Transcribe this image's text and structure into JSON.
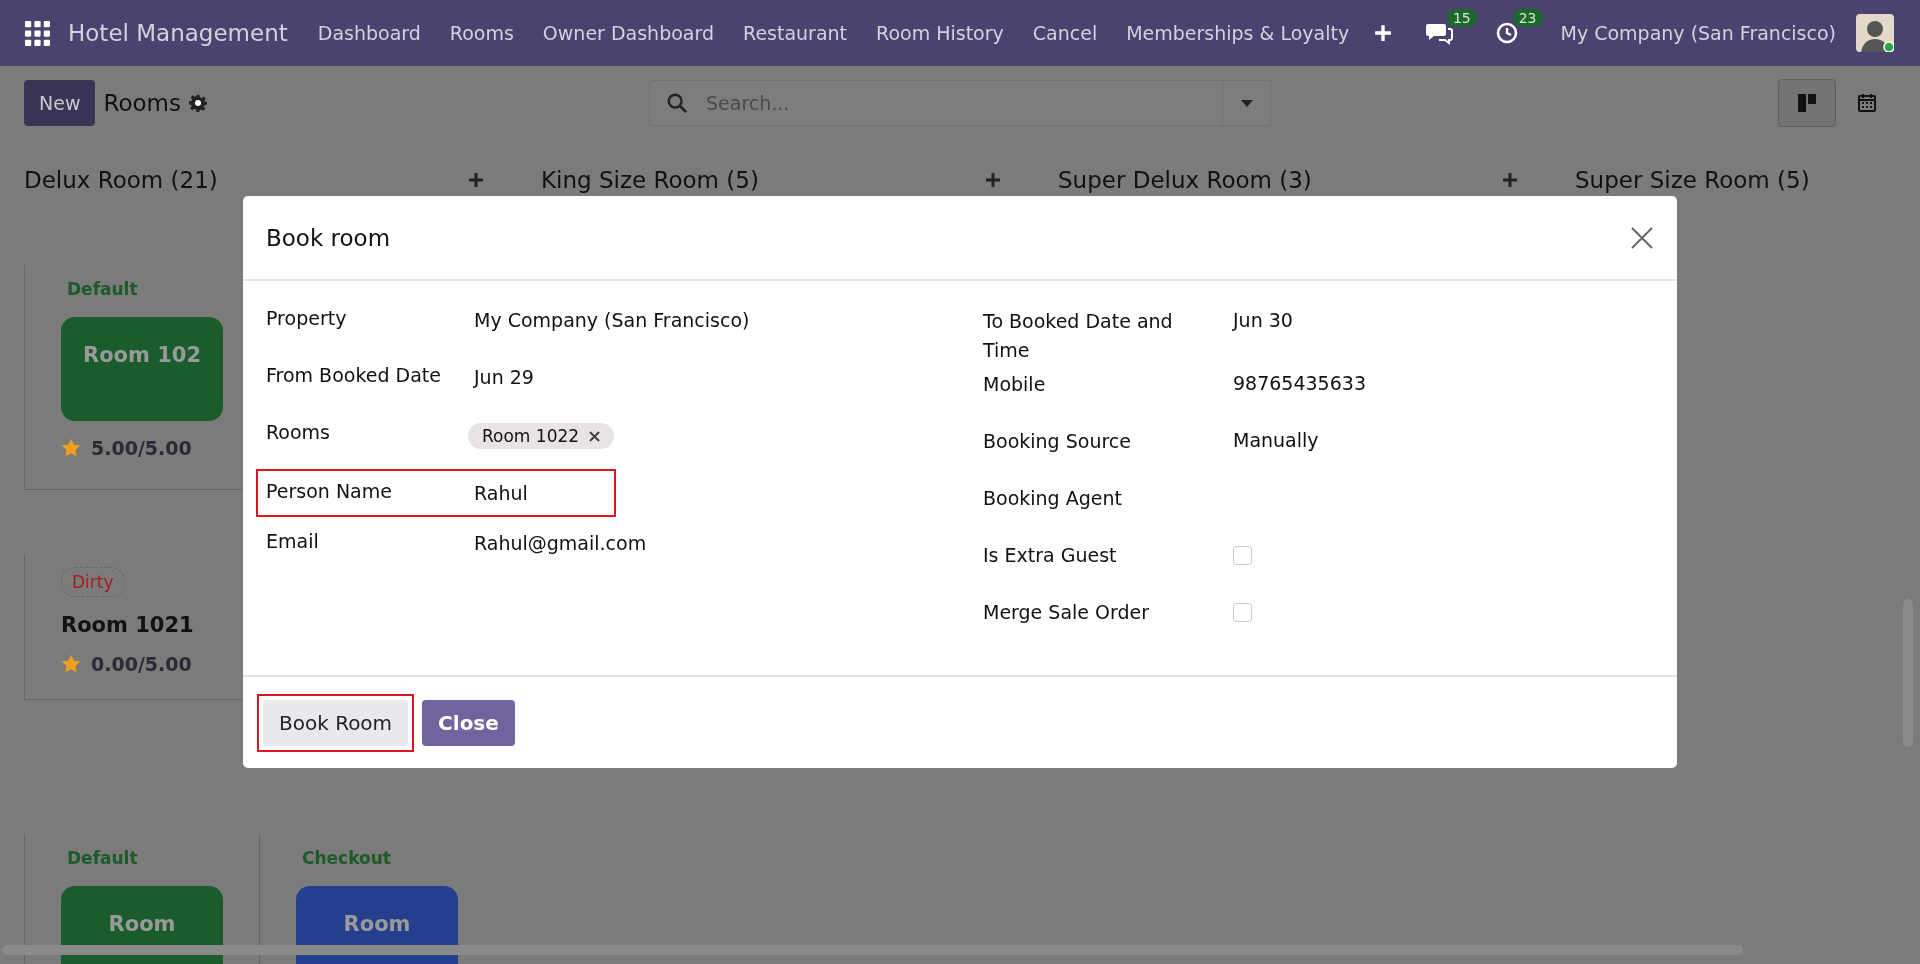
{
  "navbar": {
    "app_title": "Hotel Management",
    "menu": [
      "Dashboard",
      "Rooms",
      "Owner Dashboard",
      "Restaurant",
      "Room History",
      "Cancel",
      "Memberships & Loyalty"
    ],
    "messages_badge": "15",
    "activities_badge": "23",
    "company": "My Company (San Francisco)"
  },
  "control_panel": {
    "new_button": "New",
    "title": "Rooms",
    "search": {
      "placeholder": "Search..."
    },
    "views": [
      {
        "kind": "kanban",
        "selected": true
      },
      {
        "kind": "calendar",
        "selected": false
      }
    ]
  },
  "columns": [
    {
      "title": "Delux Room (21)",
      "cards": [
        {
          "kind": "tile",
          "status": {
            "label": "Default",
            "color": "#1d5a2a",
            "pill": false
          },
          "name": "Room 102",
          "color": "#1b5c2c",
          "rating": "5.00/5.00"
        },
        {
          "kind": "plain",
          "status": {
            "label": "Dirty",
            "color": "#a81c1c",
            "pill": true
          },
          "name": "Room 1021",
          "rating": "0.00/5.00"
        },
        {
          "kind": "tile",
          "status": {
            "label": "Default",
            "color": "#1d5a2a",
            "pill": false
          },
          "name": "Room",
          "color": "#1b5c2c"
        },
        {
          "kind": "tile",
          "status": {
            "label": "Checkout",
            "color": "#1d5a2a",
            "pill": false
          },
          "name": "Room",
          "color": "#243f8e"
        }
      ]
    },
    {
      "title": "King Size Room (5)"
    },
    {
      "title": "Super Delux Room (3)"
    },
    {
      "title": "Super Size Room (5)"
    }
  ],
  "dialog": {
    "title": "Book room",
    "left_fields": [
      {
        "kind": "text",
        "label": "Property",
        "value": "My Company (San Francisco)",
        "highlighted": false
      },
      {
        "kind": "text",
        "label": "From Booked Date",
        "value": "Jun 29",
        "highlighted": false
      },
      {
        "kind": "tags",
        "label": "Rooms",
        "tags": [
          "Room 1022"
        ],
        "highlighted": false
      },
      {
        "kind": "text",
        "label": "Person Name",
        "value": "Rahul",
        "highlighted": true
      },
      {
        "kind": "text",
        "label": "Email",
        "value": "Rahul@gmail.com",
        "highlighted": false
      }
    ],
    "right_fields": [
      {
        "kind": "text",
        "label": "To Booked Date and Time",
        "value": "Jun 30",
        "highlighted": false
      },
      {
        "kind": "text",
        "label": "Mobile",
        "value": "98765435633",
        "highlighted": false
      },
      {
        "kind": "text",
        "label": "Booking Source",
        "value": "Manually",
        "highlighted": false
      },
      {
        "kind": "text",
        "label": "Booking Agent",
        "highlighted": false
      },
      {
        "kind": "checkbox",
        "label": "Is Extra Guest",
        "checked": false,
        "highlighted": false
      },
      {
        "kind": "checkbox",
        "label": "Merge Sale Order",
        "checked": false,
        "highlighted": false
      }
    ],
    "buttons": [
      {
        "label": "Book Room",
        "kind": "secondary",
        "highlighted": true
      },
      {
        "label": "Close",
        "kind": "primary",
        "highlighted": false
      }
    ]
  }
}
